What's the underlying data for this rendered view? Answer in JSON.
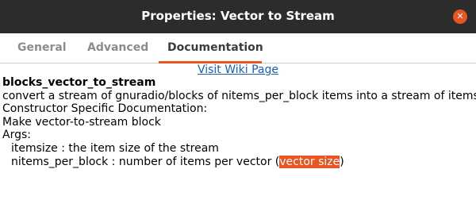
{
  "window": {
    "title": "Properties: Vector to Stream",
    "close_glyph": "✕",
    "close_color": "#e95420"
  },
  "tabs": [
    {
      "label": "General",
      "active": false
    },
    {
      "label": "Advanced",
      "active": false
    },
    {
      "label": "Documentation",
      "active": true
    }
  ],
  "accent_color": "#e95420",
  "doc": {
    "wiki_link": "Visit Wiki Page",
    "block_id": "blocks_vector_to_stream",
    "description": "convert a stream of gnuradio/blocks of nitems_per_block items into a stream of items",
    "constructor_heading": "Constructor Specific Documentation:",
    "constructor_text": "Make vector-to-stream block",
    "args_heading": "Args:",
    "arg1": "itemsize : the item size of the stream",
    "arg2_prefix": "nitems_per_block : number of items per vector (",
    "arg2_highlight": "vector size",
    "arg2_suffix": ")"
  }
}
